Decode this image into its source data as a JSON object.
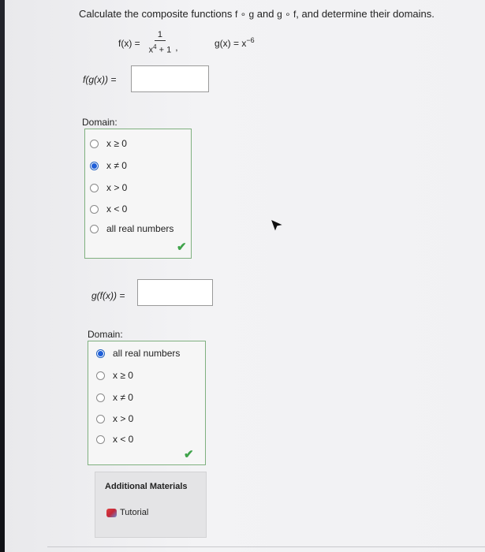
{
  "question": {
    "prefix": "Calculate the composite functions ",
    "fog": "f ∘ g",
    "and1": " and ",
    "gof": "g ∘ f",
    "suffix": ", and determine their domains."
  },
  "functions": {
    "f_label": "f(x) =",
    "f_numerator": "1",
    "f_den_base": "x",
    "f_den_exp": "4",
    "f_den_rest": " + 1",
    "comma": ",",
    "g_label": "g(x) = x",
    "g_exp": "−6"
  },
  "part1": {
    "label": "f(g(x)) =",
    "answer_value": "",
    "domain_label": "Domain:",
    "options": [
      "x ≥ 0",
      "x ≠ 0",
      "x > 0",
      "x < 0",
      "all real numbers"
    ],
    "selected_index": 1,
    "check": "✔"
  },
  "part2": {
    "label": "g(f(x)) =",
    "answer_value": "",
    "domain_label": "Domain:",
    "options": [
      "all real numbers",
      "x ≥ 0",
      "x ≠ 0",
      "x > 0",
      "x < 0"
    ],
    "selected_index": 0,
    "check": "✔"
  },
  "materials": {
    "title": "Additional Materials",
    "tutorial_label": "Tutorial"
  },
  "colors": {
    "accent_radio": "#1f5fd8",
    "check_green": "#3fa34a",
    "box_border": "#7fb07f"
  }
}
